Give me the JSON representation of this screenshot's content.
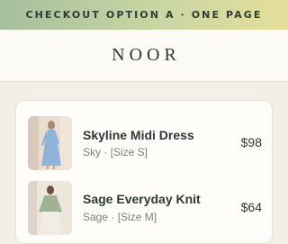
{
  "banner": {
    "text": "CHECKOUT OPTION A · ONE PAGE"
  },
  "header": {
    "brand": "NOOR"
  },
  "cart": {
    "items": [
      {
        "name": "Skyline Midi Dress",
        "variant": "Sky · [Size S]",
        "price": "$98"
      },
      {
        "name": "Sage Everyday Knit",
        "variant": "Sage · [Size M]",
        "price": "$64"
      }
    ]
  },
  "colors": {
    "banner_gradient_start": "#a6bf9c",
    "banner_gradient_end": "#e6df9a",
    "page_background": "#f3efe6",
    "text_primary": "#2c3a33"
  }
}
